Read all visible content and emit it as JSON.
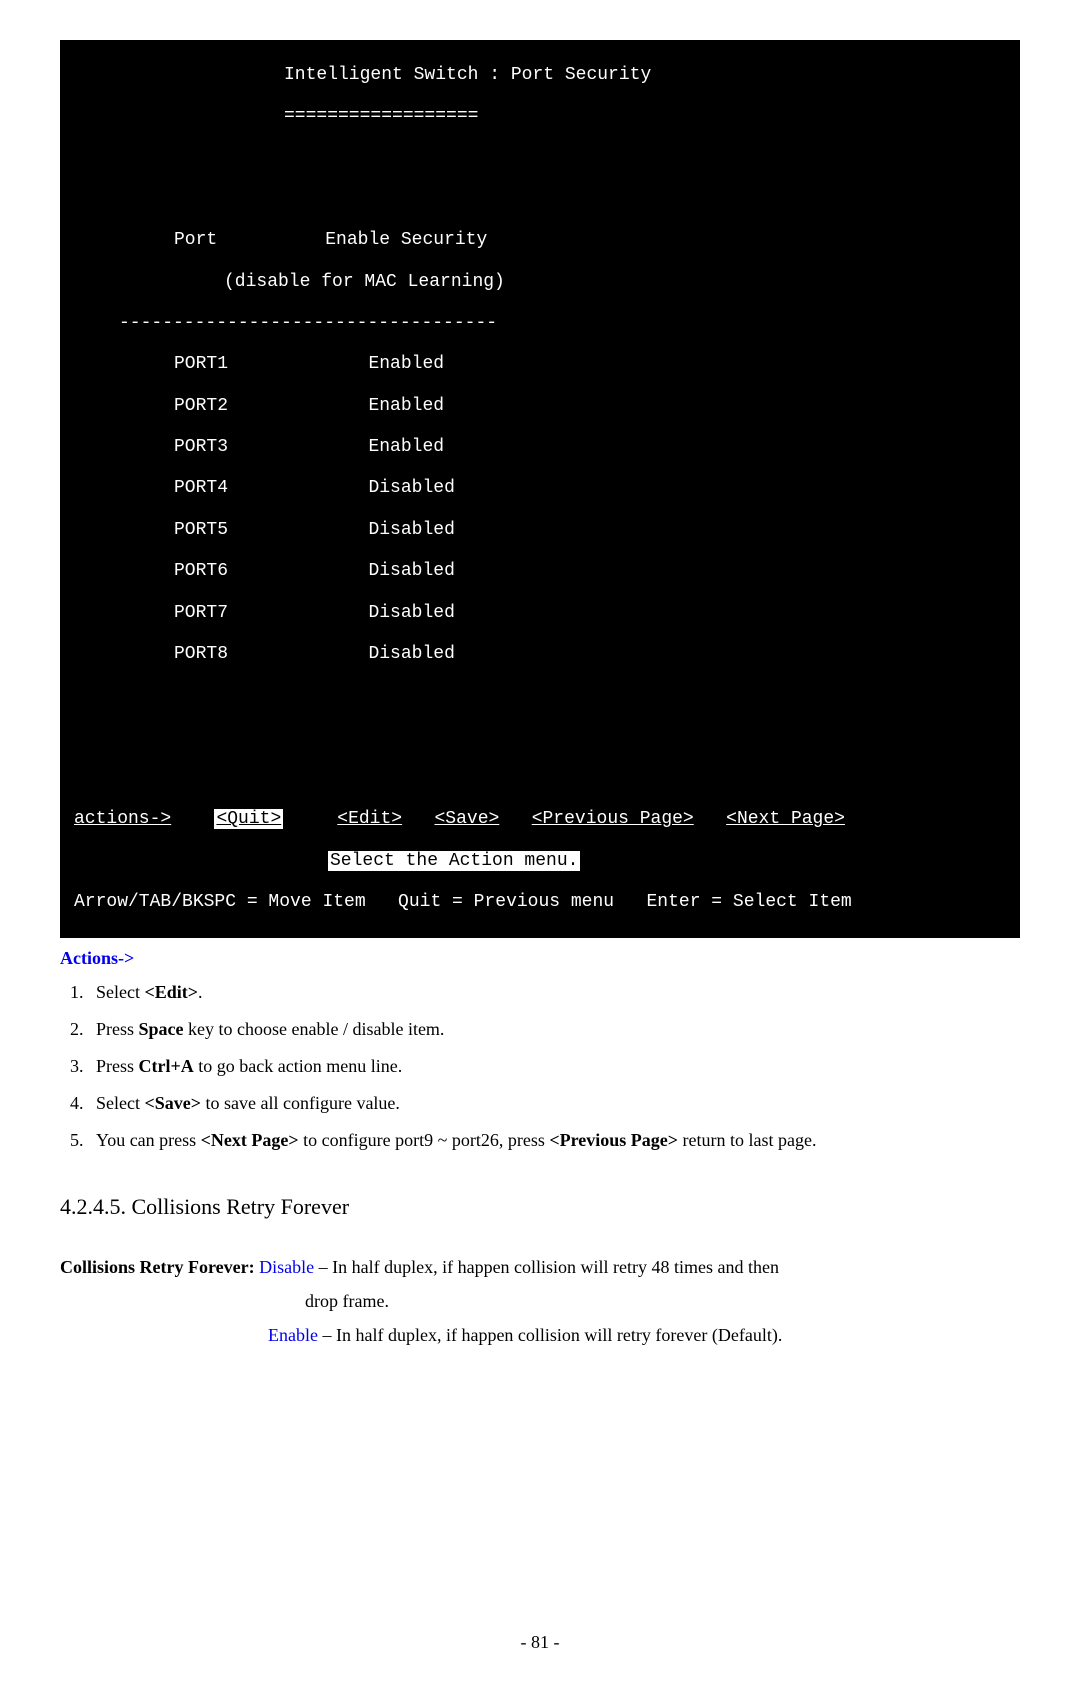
{
  "terminal": {
    "title": "Intelligent Switch : Port Security",
    "title_underline": "==================",
    "col_header_1": "Port",
    "col_header_2": "Enable Security",
    "col_header_sub": "(disable for MAC Learning)",
    "divider": "-----------------------------------",
    "rows": [
      {
        "port": "PORT1",
        "state": "Enabled"
      },
      {
        "port": "PORT2",
        "state": "Enabled"
      },
      {
        "port": "PORT3",
        "state": "Enabled"
      },
      {
        "port": "PORT4",
        "state": "Disabled"
      },
      {
        "port": "PORT5",
        "state": "Disabled"
      },
      {
        "port": "PORT6",
        "state": "Disabled"
      },
      {
        "port": "PORT7",
        "state": "Disabled"
      },
      {
        "port": "PORT8",
        "state": "Disabled"
      }
    ],
    "actions_label": "actions->",
    "actions": {
      "quit": "<Quit>",
      "edit": "<Edit>",
      "save": "<Save>",
      "prev": "<Previous Page>",
      "next": "<Next Page>"
    },
    "select_menu": "Select the Action menu.",
    "hint": "Arrow/TAB/BKSPC = Move Item   Quit = Previous menu   Enter = Select Item"
  },
  "doc": {
    "actions_heading": "Actions->",
    "step1_a": "Select ",
    "step1_b": "<Edit>",
    "step1_c": ".",
    "step2_a": "Press ",
    "step2_b": "Space",
    "step2_c": " key to choose enable / disable item.",
    "step3_a": "Press ",
    "step3_b": "Ctrl+A",
    "step3_c": " to go back action menu line.",
    "step4_a": "Select ",
    "step4_b": "<Save>",
    "step4_c": " to save all configure value.",
    "step5_a": "You can press ",
    "step5_b": "<Next Page>",
    "step5_c": " to configure port9 ~ port26, press ",
    "step5_d": "<Previous Page>",
    "step5_e": " return to last page.",
    "subheading": "4.2.4.5. Collisions Retry Forever",
    "crf_label": "Collisions Retry Forever: ",
    "crf_disable": "Disable",
    "crf_disable_text": " – In half duplex, if happen collision will retry 48 times and then",
    "crf_drop": " drop frame.",
    "crf_enable": "Enable",
    "crf_enable_text": " – In half duplex, if happen collision will retry forever (Default).",
    "page_num": "- 81 -"
  }
}
